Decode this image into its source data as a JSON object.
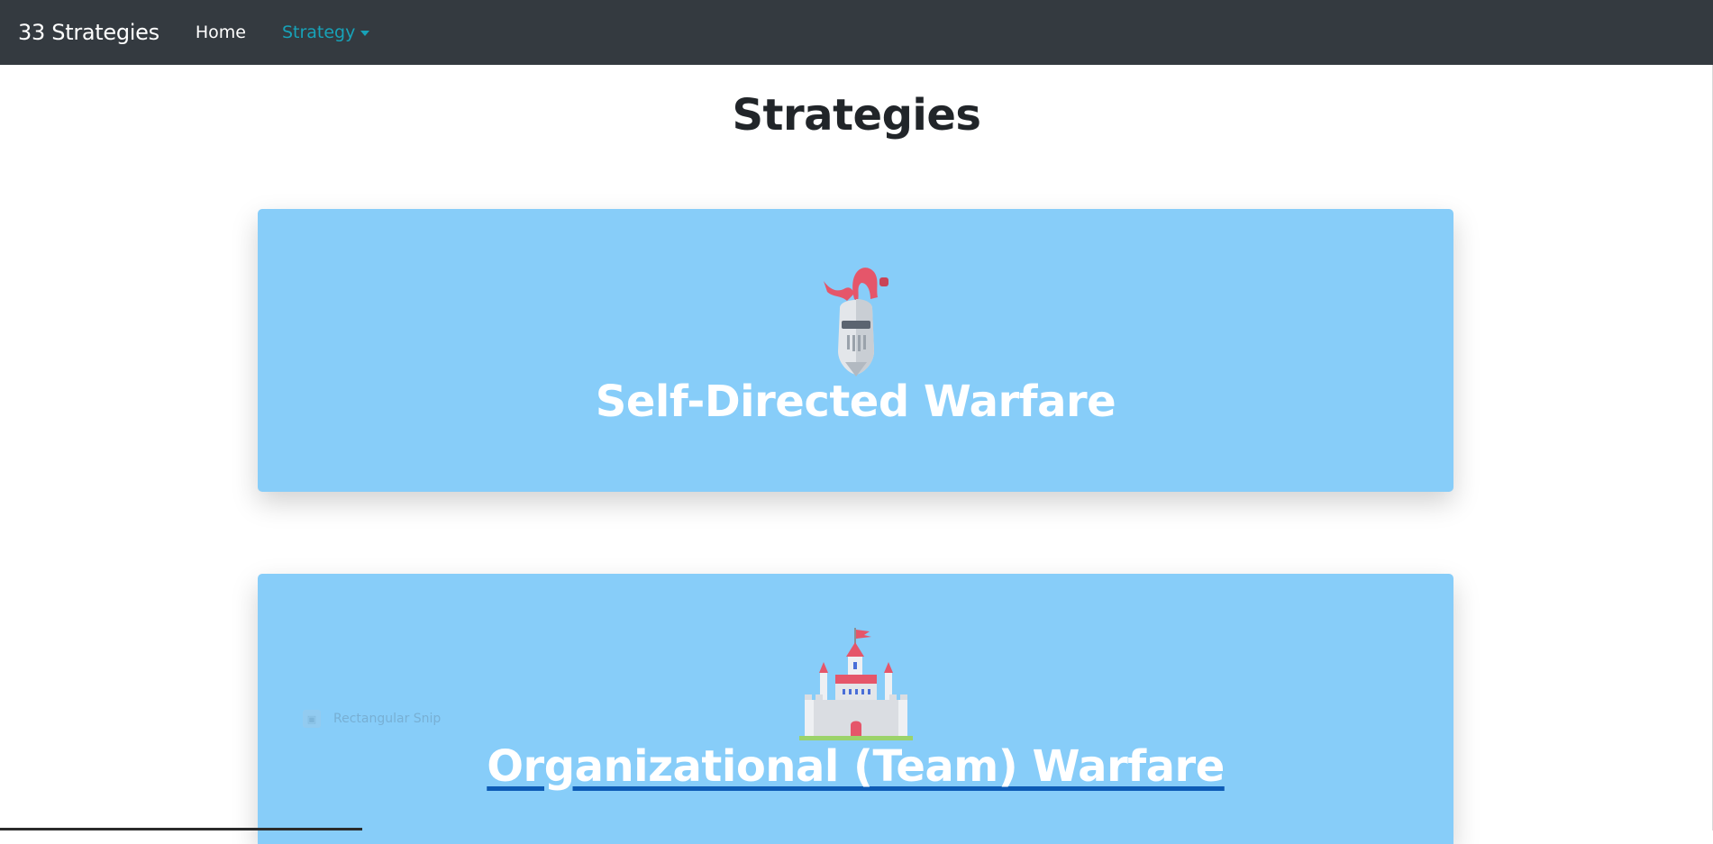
{
  "navbar": {
    "brand": "33 Strategies",
    "home_label": "Home",
    "strategy_label": "Strategy",
    "strategy_color": "#17a2b8",
    "background": "#343a40"
  },
  "page": {
    "title": "Strategies"
  },
  "cards": [
    {
      "title": "Self-Directed Warfare",
      "icon": "knight-helmet-icon",
      "background": "#87cdf9"
    },
    {
      "title": "Organizational (Team) Warfare",
      "icon": "castle-icon",
      "background": "#87cdf9"
    }
  ],
  "overlay": {
    "snip_label": "Rectangular Snip",
    "snip_icon": "snip-icon"
  }
}
